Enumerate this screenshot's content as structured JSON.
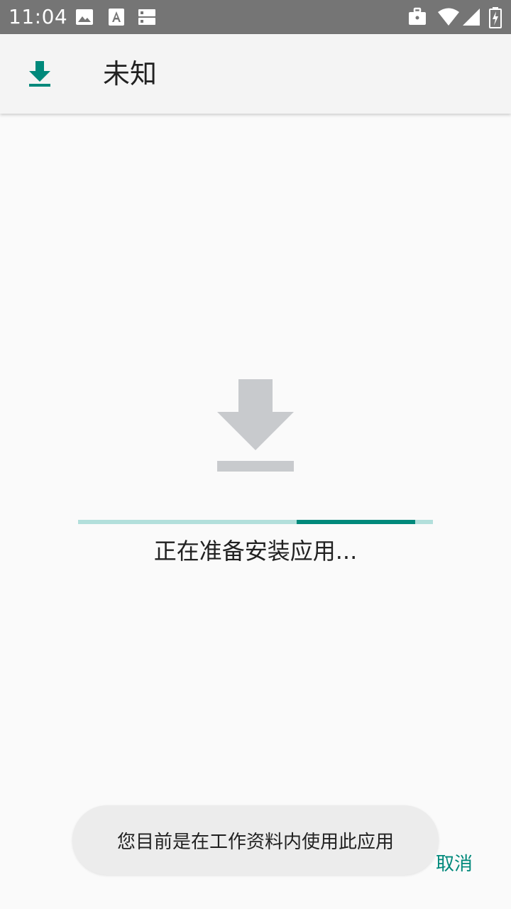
{
  "status_bar": {
    "time": "11:04",
    "left_icons": [
      "image-icon",
      "font-download-icon",
      "storage-icon"
    ],
    "right_icons": [
      "work-profile-icon",
      "wifi-icon",
      "signal-icon",
      "battery-icon"
    ]
  },
  "app_bar": {
    "icon": "download-icon",
    "title": "未知"
  },
  "main": {
    "illustration_icon": "download-icon",
    "progress_fraction": 0.333,
    "message": "正在准备安装应用..."
  },
  "toast": {
    "text": "您目前是在工作资料内使用此应用"
  },
  "actions": {
    "cancel_label": "取消"
  },
  "colors": {
    "accent": "#00897b",
    "accent_light": "#b2dfdb",
    "status_bar": "#757575",
    "app_bar": "#f4f4f4",
    "background": "#fafafa",
    "illustration": "#c8cacd"
  }
}
